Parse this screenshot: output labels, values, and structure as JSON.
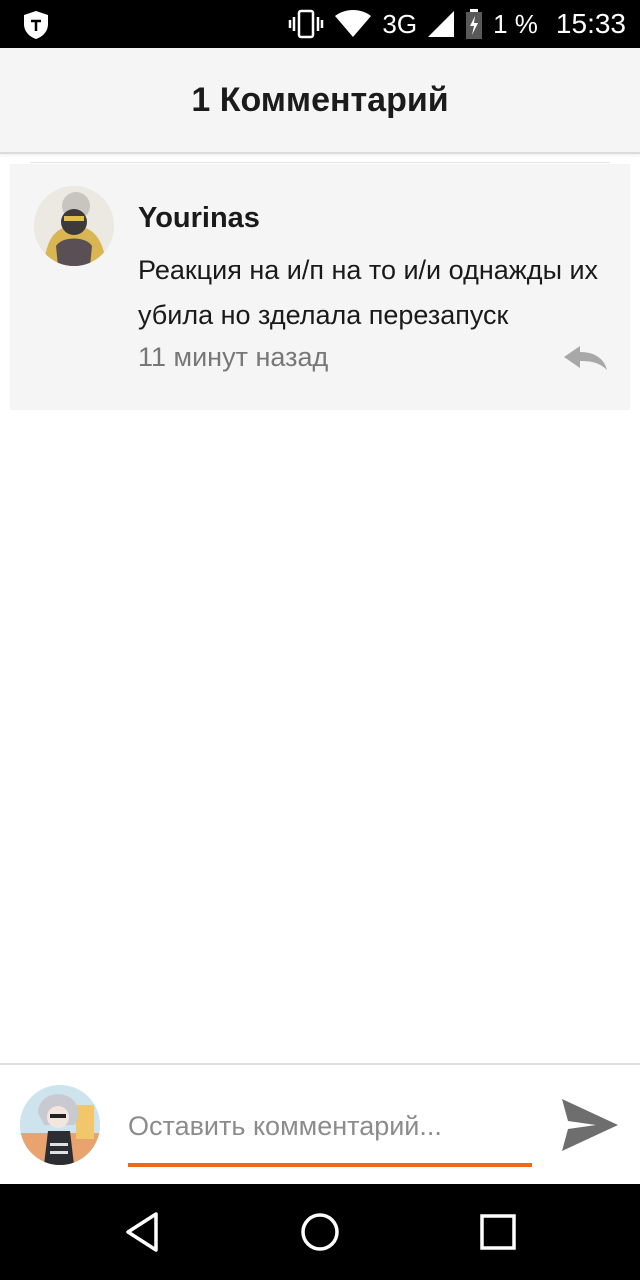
{
  "status_bar": {
    "network": "3G",
    "battery": "1 %",
    "time": "15:33",
    "icons": [
      "shield-icon",
      "vibrate-icon",
      "wifi-icon",
      "signal-icon",
      "battery-charging-icon"
    ]
  },
  "header": {
    "title": "1 Комментарий"
  },
  "comments": [
    {
      "author": "Yourinas",
      "text": "Реакция на и/п на то и/и однажды их убила но зделала перезапуск",
      "time": "11 минут назад",
      "avatar_icon": "user-avatar",
      "reply_icon": "reply-icon"
    }
  ],
  "input": {
    "placeholder": "Оставить комментарий...",
    "value": "",
    "send_icon": "send-icon"
  },
  "nav": {
    "icons": [
      "back-icon",
      "home-icon",
      "recents-icon"
    ]
  },
  "colors": {
    "accent": "#f06a16",
    "card_bg": "#f5f5f6",
    "header_bg": "#f5f5f6",
    "secondary_text": "#777777"
  }
}
